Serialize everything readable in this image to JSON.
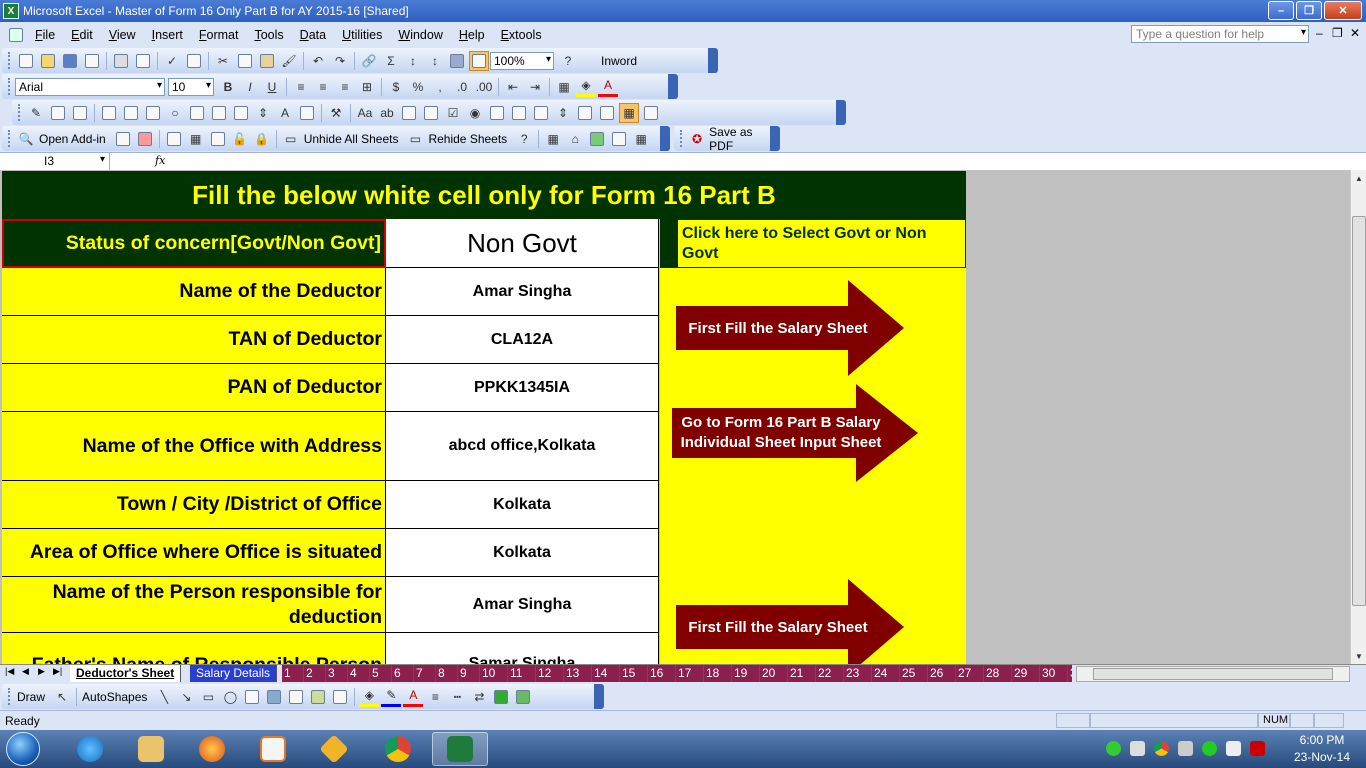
{
  "window": {
    "title": "Microsoft Excel - Master of Form 16 Only Part  B for AY 2015-16  [Shared]"
  },
  "menu": {
    "items": [
      "File",
      "Edit",
      "View",
      "Insert",
      "Format",
      "Tools",
      "Data",
      "Utilities",
      "Window",
      "Help",
      "Extools"
    ],
    "help_placeholder": "Type a question for help"
  },
  "toolbar_standard": {
    "zoom": "100%",
    "inword_label": "Inword"
  },
  "toolbar_format": {
    "font": "Arial",
    "size": "10"
  },
  "toolbar_addin": {
    "open_addin": "Open Add-in",
    "unhide_all": "Unhide All Sheets",
    "rehide": "Rehide Sheets",
    "save_pdf": "Save as PDF"
  },
  "formula_bar": {
    "cell_ref": "I3",
    "fx": "fx",
    "content": ""
  },
  "sheet": {
    "banner": "Fill the below white cell only for Form 16 Part B",
    "status_label": "Status of concern[Govt/Non Govt]",
    "status_value": "Non Govt",
    "select_button": "Click here to Select Govt or Non Govt",
    "rows": [
      {
        "label": "Name of the Deductor",
        "value": "Amar Singha"
      },
      {
        "label": "TAN of Deductor",
        "value": "CLA12A"
      },
      {
        "label": "PAN of Deductor",
        "value": "PPKK1345IA"
      },
      {
        "label": "Name of the Office with Address",
        "value": "abcd office,Kolkata"
      },
      {
        "label": "Town / City /District of Office",
        "value": "Kolkata"
      },
      {
        "label": "Area of Office where Office is situated",
        "value": "Kolkata"
      },
      {
        "label": "Name of the Person responsible for deduction",
        "value": "Amar Singha"
      },
      {
        "label": "Father's Name of Responsible Person",
        "value": "Samar Singha"
      }
    ],
    "arrows": [
      "First Fill the Salary Sheet",
      "Go to Form 16 Part B Salary Individual Sheet Input Sheet",
      "First Fill the Salary Sheet"
    ]
  },
  "tabs": {
    "active": "Deductor's Sheet",
    "second": "Salary Details",
    "numbered": [
      "1",
      "2",
      "3",
      "4",
      "5",
      "6",
      "7",
      "8",
      "9",
      "10",
      "11",
      "12",
      "13",
      "14",
      "15",
      "16",
      "17",
      "18",
      "19",
      "20",
      "21",
      "22",
      "23",
      "24",
      "25",
      "26",
      "27",
      "28",
      "29",
      "30",
      "3"
    ]
  },
  "drawbar": {
    "draw": "Draw",
    "autoshapes": "AutoShapes"
  },
  "status": {
    "left": "Ready",
    "num": "NUM"
  },
  "taskbar": {
    "time": "6:00 PM",
    "date": "23-Nov-14"
  },
  "colors": {
    "banner_bg": "#003300",
    "banner_text": "#ffff00",
    "label_bg": "#ffff00",
    "arrow": "#800000",
    "tab_num": "#8b1f4e"
  }
}
